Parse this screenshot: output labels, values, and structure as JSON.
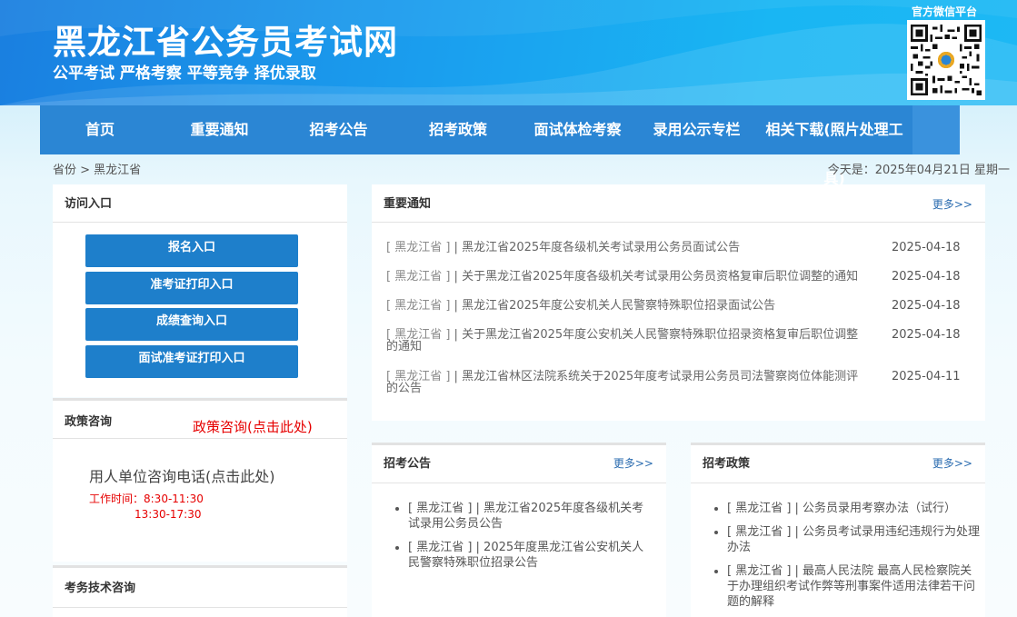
{
  "header": {
    "title": "黑龙江省公务员考试网",
    "slogan": "公平考试 严格考察 平等竞争 择优录取",
    "wechat_label": "官方微信平台",
    "qr_icon": "qr-code-icon"
  },
  "nav": {
    "items": [
      {
        "label": "首页"
      },
      {
        "label": "重要通知"
      },
      {
        "label": "招考公告"
      },
      {
        "label": "招考政策"
      },
      {
        "label": "面试体检考察"
      },
      {
        "label": "录用公示专栏"
      },
      {
        "label": "相关下载(照片处理工具)"
      }
    ]
  },
  "breadcrumb": "省份 > 黑龙江省",
  "today": "今天是：2025年04月21日 星期一",
  "access": {
    "title": "访问入口",
    "buttons": [
      {
        "label": "报名入口"
      },
      {
        "label": "准考证打印入口"
      },
      {
        "label": "成绩查询入口"
      },
      {
        "label": "面试准考证打印入口"
      }
    ]
  },
  "policy_consult": {
    "title": "政策咨询",
    "link": "政策咨询(点击此处)",
    "phone_link": "用人单位咨询电话(点击此处)",
    "worktime_line1": "工作时间：8:30-11:30",
    "worktime_line2": "13:30-17:30"
  },
  "tech_consult": {
    "title": "考务技术咨询"
  },
  "notices": {
    "title": "重要通知",
    "more": "更多>>",
    "items": [
      {
        "tag": "[ 黑龙江省 ]",
        "sep": " | ",
        "text": "黑龙江省2025年度各级机关考试录用公务员面试公告",
        "date": "2025-04-18"
      },
      {
        "tag": "[ 黑龙江省 ]",
        "sep": " | ",
        "text": "关于黑龙江省2025年度各级机关考试录用公务员资格复审后职位调整的通知",
        "date": "2025-04-18"
      },
      {
        "tag": "[ 黑龙江省 ]",
        "sep": " | ",
        "text": "黑龙江省2025年度公安机关人民警察特殊职位招录面试公告",
        "date": "2025-04-18"
      },
      {
        "tag": "[ 黑龙江省 ]",
        "sep": " | ",
        "text": "关于黑龙江省2025年度公安机关人民警察特殊职位招录资格复审后职位调整的通知",
        "date": "2025-04-18"
      },
      {
        "tag": "[ 黑龙江省 ]",
        "sep": " | ",
        "text": "黑龙江省林区法院系统关于2025年度考试录用公务员司法警察岗位体能测评的公告",
        "date": "2025-04-11"
      }
    ]
  },
  "announcements": {
    "title": "招考公告",
    "more": "更多>>",
    "items": [
      {
        "text": "[ 黑龙江省 ] | 黑龙江省2025年度各级机关考试录用公务员公告"
      },
      {
        "text": "[ 黑龙江省 ] | 2025年度黑龙江省公安机关人民警察特殊职位招录公告"
      }
    ]
  },
  "policies": {
    "title": "招考政策",
    "more": "更多>>",
    "items": [
      {
        "text": "[ 黑龙江省 ] | 公务员录用考察办法（试行）"
      },
      {
        "text": "[ 黑龙江省 ] | 公务员考试录用违纪违规行为处理办法"
      },
      {
        "text": "[ 黑龙江省 ] | 最高人民法院 最高人民检察院关于办理组织考试作弊等刑事案件适用法律若干问题的解释"
      }
    ]
  }
}
